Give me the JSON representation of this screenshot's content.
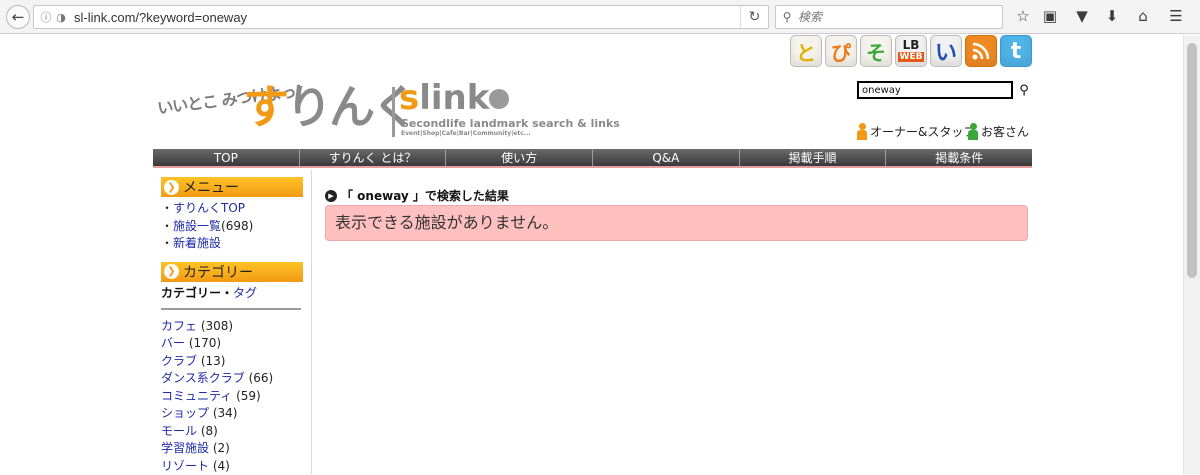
{
  "browser": {
    "url": "sl-link.com/?keyword=oneway",
    "search_placeholder": "検索"
  },
  "social": {
    "tobi": "と",
    "pi": "ぴ",
    "so": "そ",
    "lb_top": "LB",
    "lb_bottom": "WEB",
    "ii": "い",
    "rss": "RSS",
    "twitter": "t"
  },
  "logo": {
    "jp_small": "いいとこ みつけよっ!",
    "jp_big_first": "す",
    "jp_big_rest": "りんく",
    "en_big_first": "s",
    "en_big_rest": "link",
    "tagline": "Secondlife landmark search & links",
    "subtagline": "Event|Shop|Cafe|Bar|Community|etc..."
  },
  "site_search": {
    "value": "oneway"
  },
  "header_links": {
    "owner": "オーナー&スタッフ",
    "guest": "お客さん"
  },
  "nav": [
    "TOP",
    "すりんく とは？",
    "使い方",
    "Q&A",
    "掲載手順",
    "掲載条件"
  ],
  "sidebar": {
    "menu_title": "メニュー",
    "menu_items": [
      {
        "label": "すりんくTOP",
        "count": ""
      },
      {
        "label": "施設一覧",
        "count": "(698)"
      },
      {
        "label": "新着施設",
        "count": ""
      }
    ],
    "category_title": "カテゴリー",
    "category_tab_active": "カテゴリー",
    "category_tab_sep": "・",
    "category_tab_other": "タグ",
    "categories": [
      {
        "label": "カフェ",
        "count": "(308)"
      },
      {
        "label": "バー",
        "count": "(170)"
      },
      {
        "label": "クラブ",
        "count": "(13)"
      },
      {
        "label": "ダンス系クラブ",
        "count": "(66)"
      },
      {
        "label": "コミュニティ",
        "count": "(59)"
      },
      {
        "label": "ショップ",
        "count": "(34)"
      },
      {
        "label": "モール",
        "count": "(8)"
      },
      {
        "label": "学習施設",
        "count": "(2)"
      },
      {
        "label": "リゾート",
        "count": "(4)"
      }
    ]
  },
  "result": {
    "heading": "「 oneway 」で検索した結果",
    "empty_message": "表示できる施設がありません。"
  }
}
